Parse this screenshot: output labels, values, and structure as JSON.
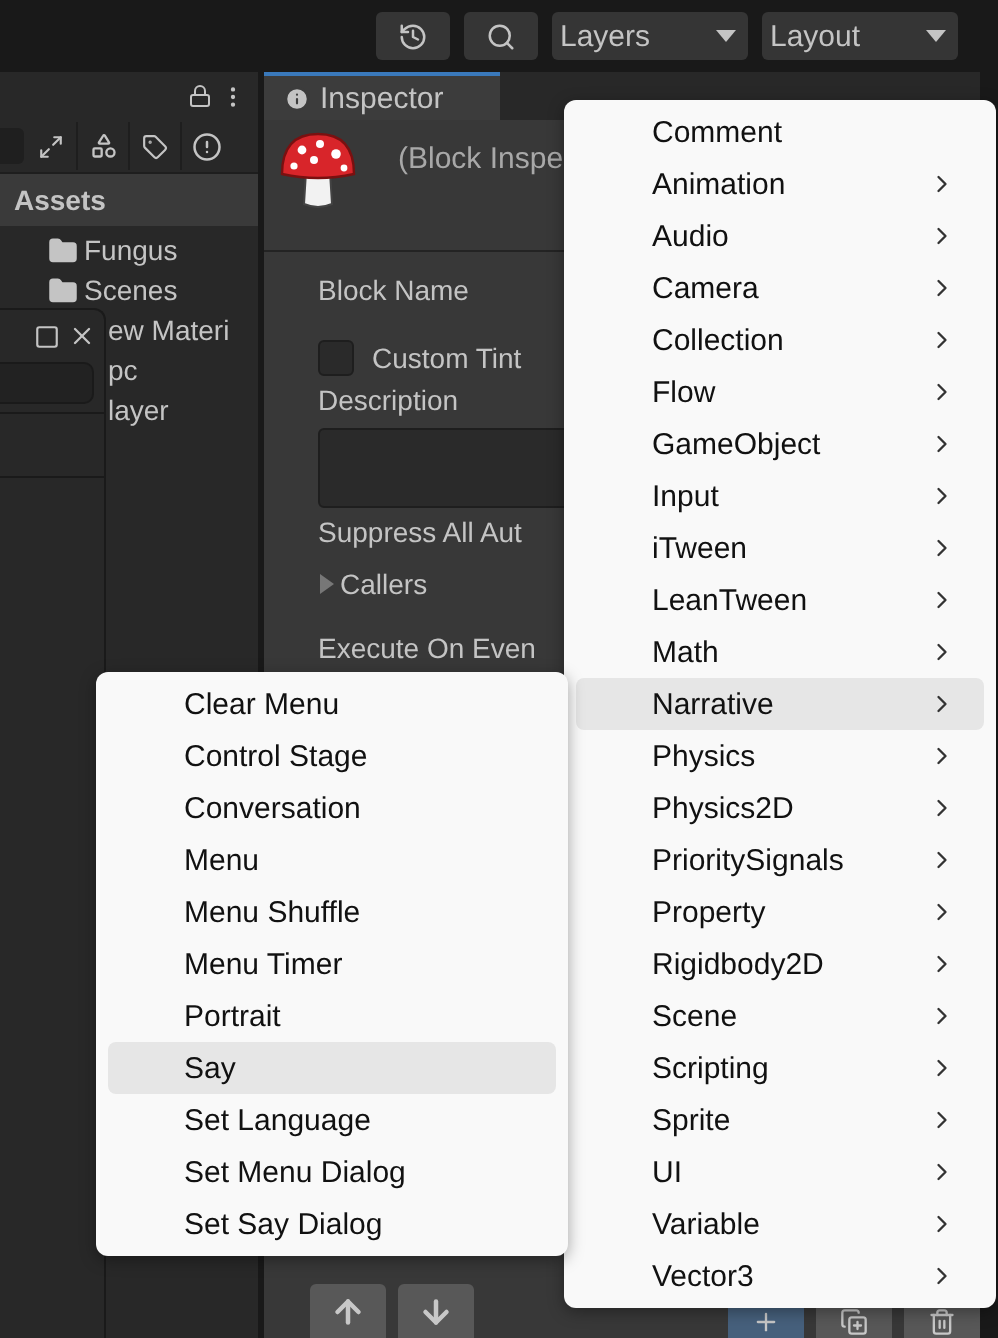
{
  "toolbar": {
    "dropdowns": [
      {
        "label": "Layers"
      },
      {
        "label": "Layout"
      }
    ]
  },
  "project_panel": {
    "section": "Assets",
    "items": [
      {
        "label": "Fungus",
        "kind": "folder"
      },
      {
        "label": "Scenes",
        "kind": "folder"
      },
      {
        "label": "ew Materi",
        "kind": "covered"
      },
      {
        "label": "pc",
        "kind": "covered"
      },
      {
        "label": "layer",
        "kind": "covered"
      }
    ]
  },
  "inspector": {
    "tab": "Inspector",
    "title": "(Block Inspe",
    "fields": [
      {
        "kind": "label",
        "label": "Block Name"
      },
      {
        "kind": "checkbox",
        "label": "Custom Tint",
        "checked": false
      },
      {
        "kind": "label",
        "label": "Description"
      },
      {
        "kind": "textarea"
      },
      {
        "kind": "label",
        "label": "Suppress All Aut"
      },
      {
        "kind": "foldout",
        "label": "Callers",
        "expanded": false
      },
      {
        "kind": "label",
        "label": "Execute On Even"
      }
    ]
  },
  "context_menu": {
    "items": [
      {
        "label": "Comment",
        "submenu": false,
        "selected": false
      },
      {
        "label": "Animation",
        "submenu": true,
        "selected": false
      },
      {
        "label": "Audio",
        "submenu": true,
        "selected": false
      },
      {
        "label": "Camera",
        "submenu": true,
        "selected": false
      },
      {
        "label": "Collection",
        "submenu": true,
        "selected": false
      },
      {
        "label": "Flow",
        "submenu": true,
        "selected": false
      },
      {
        "label": "GameObject",
        "submenu": true,
        "selected": false
      },
      {
        "label": "Input",
        "submenu": true,
        "selected": false
      },
      {
        "label": "iTween",
        "submenu": true,
        "selected": false
      },
      {
        "label": "LeanTween",
        "submenu": true,
        "selected": false
      },
      {
        "label": "Math",
        "submenu": true,
        "selected": false
      },
      {
        "label": "Narrative",
        "submenu": true,
        "selected": true
      },
      {
        "label": "Physics",
        "submenu": true,
        "selected": false
      },
      {
        "label": "Physics2D",
        "submenu": true,
        "selected": false
      },
      {
        "label": "PrioritySignals",
        "submenu": true,
        "selected": false
      },
      {
        "label": "Property",
        "submenu": true,
        "selected": false
      },
      {
        "label": "Rigidbody2D",
        "submenu": true,
        "selected": false
      },
      {
        "label": "Scene",
        "submenu": true,
        "selected": false
      },
      {
        "label": "Scripting",
        "submenu": true,
        "selected": false
      },
      {
        "label": "Sprite",
        "submenu": true,
        "selected": false
      },
      {
        "label": "UI",
        "submenu": true,
        "selected": false
      },
      {
        "label": "Variable",
        "submenu": true,
        "selected": false
      },
      {
        "label": "Vector3",
        "submenu": true,
        "selected": false
      }
    ]
  },
  "submenu": {
    "items": [
      {
        "label": "Clear Menu",
        "selected": false
      },
      {
        "label": "Control Stage",
        "selected": false
      },
      {
        "label": "Conversation",
        "selected": false
      },
      {
        "label": "Menu",
        "selected": false
      },
      {
        "label": "Menu Shuffle",
        "selected": false
      },
      {
        "label": "Menu Timer",
        "selected": false
      },
      {
        "label": "Portrait",
        "selected": false
      },
      {
        "label": "Say",
        "selected": true
      },
      {
        "label": "Set Language",
        "selected": false
      },
      {
        "label": "Set Menu Dialog",
        "selected": false
      },
      {
        "label": "Set Say Dialog",
        "selected": false
      }
    ]
  }
}
